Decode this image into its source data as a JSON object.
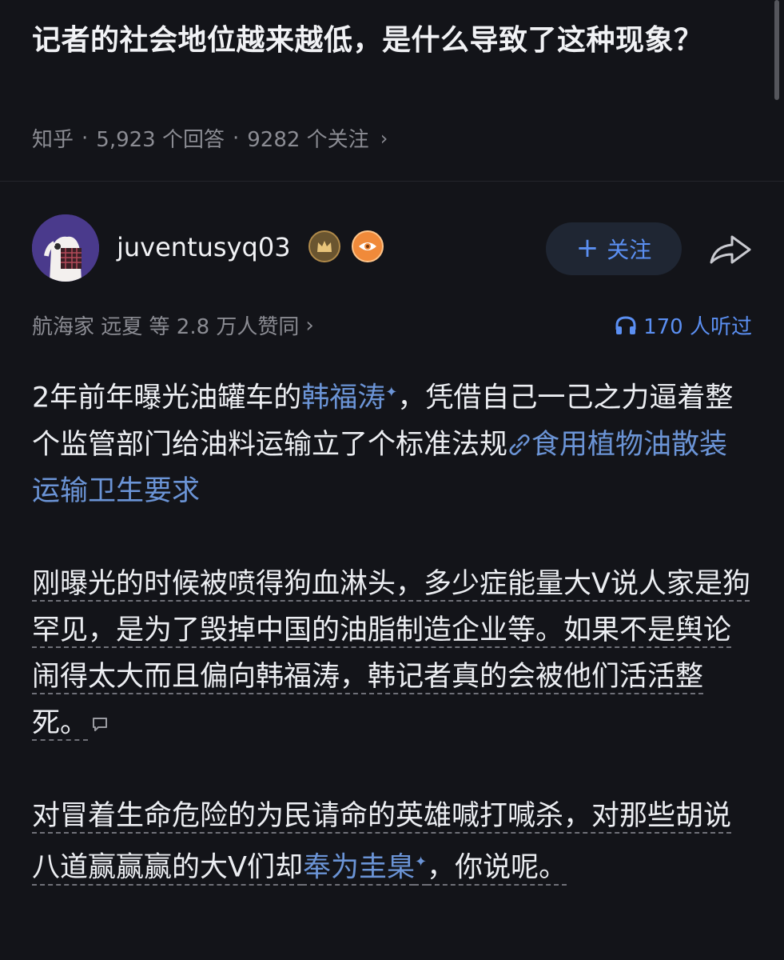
{
  "question": {
    "title": "记者的社会地位越来越低，是什么导致了这种现象？",
    "source": "知乎",
    "answers": "5,923 个回答",
    "followers": "9282 个关注"
  },
  "author": {
    "name": "juventusyq03",
    "follow_label": "关注"
  },
  "stats": {
    "voters": "航海家 远夏 等 2.8 万人赞同",
    "listened": "170 人听过"
  },
  "answer": {
    "p1_a": "2年前年曝光油罐车的",
    "p1_link1": "韩福涛",
    "p1_b": "，凭借自己一己之力逼着整个监管部门给油料运输立了个标准法规",
    "p1_link2": "食用植物油散装运输卫生要求",
    "p2": "刚曝光的时候被喷得狗血淋头，多少症能量大V说人家是狗罕见，是为了毁掉中国的油脂制造企业等。如果不是舆论闹得太大而且偏向韩福涛，韩记者真的会被他们活活整死。",
    "p3_a": "对冒着生命危险的为民请命的英雄喊打喊杀，对那些胡说八道赢赢赢的大V们却",
    "p3_link": "奉为圭臬",
    "p3_b": "，你说呢。"
  },
  "colors": {
    "background": "#131419",
    "accent": "#5b8ff2",
    "link": "#6b94d6"
  },
  "icons": [
    "crown-badge-icon",
    "eye-badge-icon",
    "plus-icon",
    "share-icon",
    "headphones-icon",
    "link-icon",
    "sparkle-icon",
    "comment-icon",
    "chevron-right-icon"
  ]
}
